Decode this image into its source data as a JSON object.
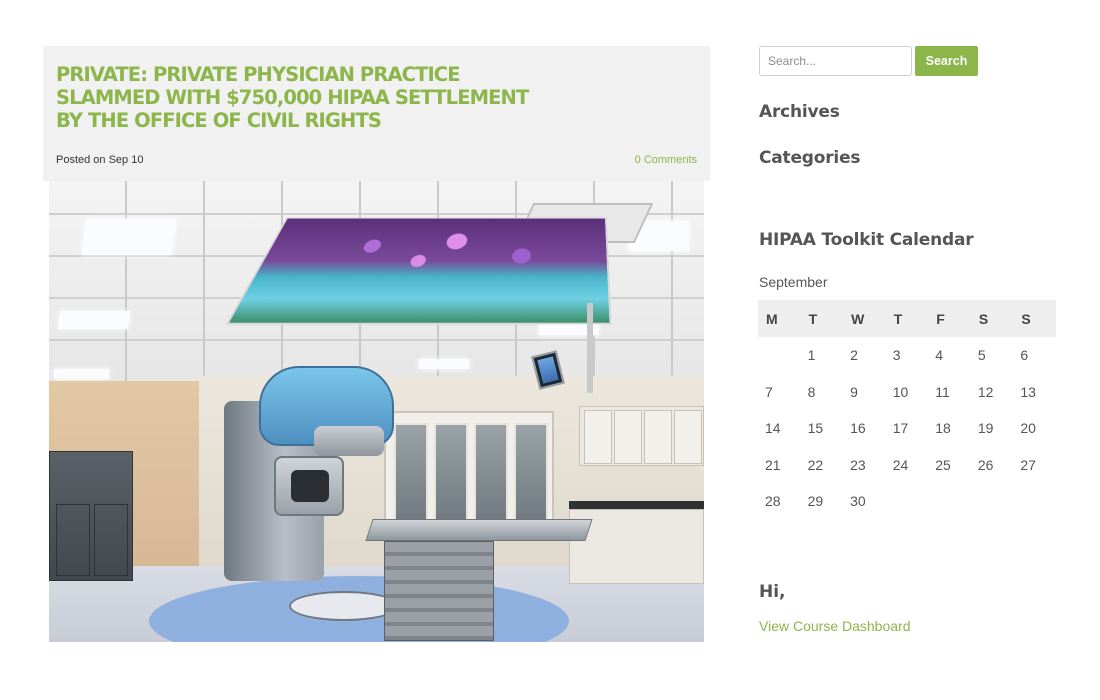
{
  "post": {
    "title_lines": [
      "Private: Private Physician Practice",
      "Slammed with $750,000 HIPAA Settlement",
      "by the Office of Civil Rights"
    ],
    "posted_on": "Posted on Sep 10",
    "comments": "0 Comments",
    "image_subject": "radiation-therapy-room-photo"
  },
  "sidebar": {
    "search": {
      "placeholder": "Search...",
      "button_label": "Search"
    },
    "archives_title": "Archives",
    "categories_title": "Categories",
    "calendar": {
      "title": "HIPAA Toolkit Calendar",
      "month": "September",
      "weekdays": [
        "M",
        "T",
        "W",
        "T",
        "F",
        "S",
        "S"
      ],
      "weeks": [
        [
          "",
          "1",
          "2",
          "3",
          "4",
          "5",
          "6"
        ],
        [
          "7",
          "8",
          "9",
          "10",
          "11",
          "12",
          "13"
        ],
        [
          "14",
          "15",
          "16",
          "17",
          "18",
          "19",
          "20"
        ],
        [
          "21",
          "22",
          "23",
          "24",
          "25",
          "26",
          "27"
        ],
        [
          "28",
          "29",
          "30",
          "",
          "",
          "",
          ""
        ]
      ]
    },
    "greeting": "Hi,",
    "dashboard_link": "View Course Dashboard"
  },
  "colors": {
    "accent": "#8cb54a",
    "card_bg": "#f1f1f1",
    "text": "#555555"
  }
}
